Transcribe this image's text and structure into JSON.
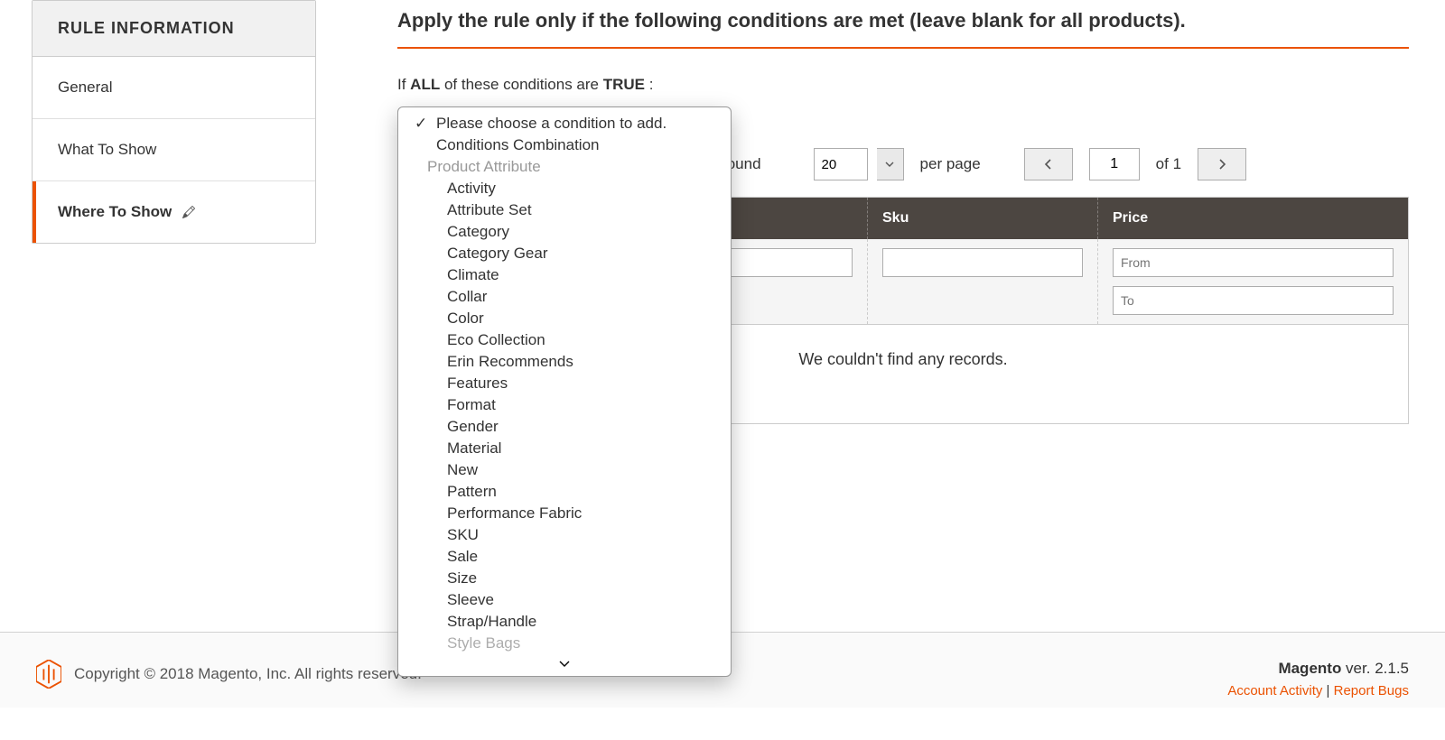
{
  "sidebar": {
    "header": "RULE INFORMATION",
    "items": [
      {
        "label": "General"
      },
      {
        "label": "What To Show"
      },
      {
        "label": "Where To Show",
        "active": true
      }
    ]
  },
  "section": {
    "title": "Apply the rule only if the following conditions are met (leave blank for all products).",
    "cond_prefix": "If ",
    "cond_all": "ALL",
    "cond_mid": " of these conditions are ",
    "cond_true": "TRUE",
    "cond_suffix": " :"
  },
  "dropdown": {
    "placeholder": "Please choose a condition to add.",
    "items": [
      {
        "type": "option",
        "label": "Conditions Combination"
      },
      {
        "type": "group",
        "label": "Product Attribute"
      },
      {
        "type": "sub",
        "label": "Activity"
      },
      {
        "type": "sub",
        "label": "Attribute Set"
      },
      {
        "type": "sub",
        "label": "Category"
      },
      {
        "type": "sub",
        "label": "Category Gear"
      },
      {
        "type": "sub",
        "label": "Climate"
      },
      {
        "type": "sub",
        "label": "Collar"
      },
      {
        "type": "sub",
        "label": "Color"
      },
      {
        "type": "sub",
        "label": "Eco Collection"
      },
      {
        "type": "sub",
        "label": "Erin Recommends"
      },
      {
        "type": "sub",
        "label": "Features"
      },
      {
        "type": "sub",
        "label": "Format"
      },
      {
        "type": "sub",
        "label": "Gender"
      },
      {
        "type": "sub",
        "label": "Material"
      },
      {
        "type": "sub",
        "label": "New"
      },
      {
        "type": "sub",
        "label": "Pattern"
      },
      {
        "type": "sub",
        "label": "Performance Fabric"
      },
      {
        "type": "sub",
        "label": "SKU"
      },
      {
        "type": "sub",
        "label": "Sale"
      },
      {
        "type": "sub",
        "label": "Size"
      },
      {
        "type": "sub",
        "label": "Sleeve"
      },
      {
        "type": "sub",
        "label": "Strap/Handle"
      },
      {
        "type": "sub-cut",
        "label": "Style Bags"
      }
    ]
  },
  "grid": {
    "found_label": "found",
    "per_page_value": "20",
    "per_page_label": "per page",
    "page_value": "1",
    "of_label": "of 1",
    "columns": {
      "c1": "",
      "sku": "Sku",
      "price": "Price"
    },
    "filter_from_placeholder": "From",
    "filter_to_placeholder": "To",
    "empty_message": "We couldn't find any records."
  },
  "footer": {
    "copyright": "Copyright © 2018 Magento, Inc. All rights reserved.",
    "brand": "Magento",
    "ver_label": " ver. ",
    "version": "2.1.5",
    "account_activity": "Account Activity",
    "sep": " | ",
    "report_bugs": "Report Bugs"
  }
}
